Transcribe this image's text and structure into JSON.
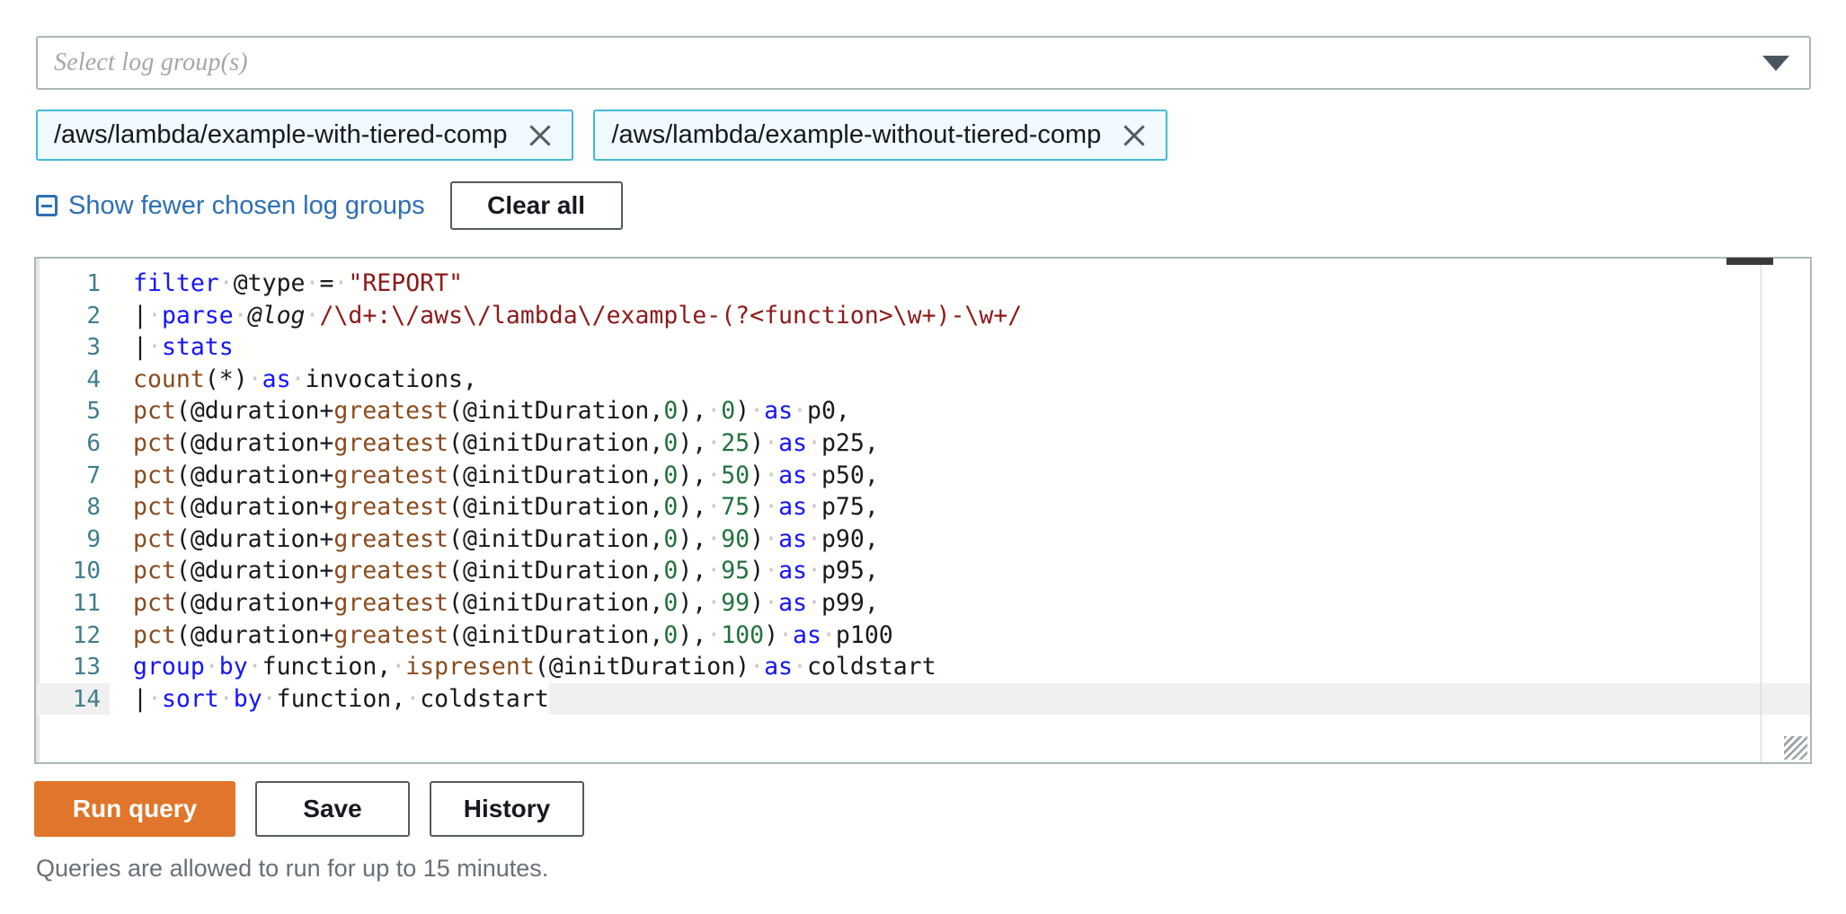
{
  "log_group_select": {
    "placeholder": "Select log group(s)",
    "caret_icon": "chevron-down-icon"
  },
  "selected_log_groups": [
    {
      "label": "/aws/lambda/example-with-tiered-comp",
      "remove_icon": "close-icon"
    },
    {
      "label": "/aws/lambda/example-without-tiered-comp",
      "remove_icon": "close-icon"
    }
  ],
  "controls": {
    "show_fewer_label": "Show fewer chosen log groups",
    "show_fewer_icon": "collapse-minus-icon",
    "clear_all_label": "Clear all"
  },
  "editor": {
    "active_line": 14,
    "lines": [
      {
        "n": "1",
        "tokens": [
          {
            "t": "filter",
            "c": "kw"
          },
          {
            "t": " ",
            "c": "dot"
          },
          {
            "t": "@type",
            "c": "var"
          },
          {
            "t": " ",
            "c": "dot"
          },
          {
            "t": "=",
            "c": "plain"
          },
          {
            "t": " ",
            "c": "dot"
          },
          {
            "t": "\"REPORT\"",
            "c": "str"
          }
        ]
      },
      {
        "n": "2",
        "tokens": [
          {
            "t": "|",
            "c": "pipe"
          },
          {
            "t": " ",
            "c": "dot"
          },
          {
            "t": "parse",
            "c": "kw"
          },
          {
            "t": " ",
            "c": "dot"
          },
          {
            "t": "@log",
            "c": "varI"
          },
          {
            "t": " ",
            "c": "dot"
          },
          {
            "t": "/\\d+:\\/aws\\/lambda\\/example-(?<function>\\w+)-\\w+/",
            "c": "str"
          }
        ]
      },
      {
        "n": "3",
        "tokens": [
          {
            "t": "|",
            "c": "pipe"
          },
          {
            "t": " ",
            "c": "dot"
          },
          {
            "t": "stats",
            "c": "kw"
          }
        ]
      },
      {
        "n": "4",
        "tokens": [
          {
            "t": "count",
            "c": "fn"
          },
          {
            "t": "(*)",
            "c": "plain"
          },
          {
            "t": " ",
            "c": "dot"
          },
          {
            "t": "as",
            "c": "kw"
          },
          {
            "t": " ",
            "c": "dot"
          },
          {
            "t": "invocations,",
            "c": "plain"
          }
        ]
      },
      {
        "n": "5",
        "tokens": [
          {
            "t": "pct",
            "c": "fn"
          },
          {
            "t": "(@duration+",
            "c": "plain"
          },
          {
            "t": "greatest",
            "c": "fn"
          },
          {
            "t": "(@initDuration,",
            "c": "plain"
          },
          {
            "t": "0",
            "c": "num"
          },
          {
            "t": "),",
            "c": "plain"
          },
          {
            "t": " ",
            "c": "dot"
          },
          {
            "t": "0",
            "c": "num"
          },
          {
            "t": ")",
            "c": "plain"
          },
          {
            "t": " ",
            "c": "dot"
          },
          {
            "t": "as",
            "c": "kw"
          },
          {
            "t": " ",
            "c": "dot"
          },
          {
            "t": "p0,",
            "c": "plain"
          }
        ]
      },
      {
        "n": "6",
        "tokens": [
          {
            "t": "pct",
            "c": "fn"
          },
          {
            "t": "(@duration+",
            "c": "plain"
          },
          {
            "t": "greatest",
            "c": "fn"
          },
          {
            "t": "(@initDuration,",
            "c": "plain"
          },
          {
            "t": "0",
            "c": "num"
          },
          {
            "t": "),",
            "c": "plain"
          },
          {
            "t": " ",
            "c": "dot"
          },
          {
            "t": "25",
            "c": "num"
          },
          {
            "t": ")",
            "c": "plain"
          },
          {
            "t": " ",
            "c": "dot"
          },
          {
            "t": "as",
            "c": "kw"
          },
          {
            "t": " ",
            "c": "dot"
          },
          {
            "t": "p25,",
            "c": "plain"
          }
        ]
      },
      {
        "n": "7",
        "tokens": [
          {
            "t": "pct",
            "c": "fn"
          },
          {
            "t": "(@duration+",
            "c": "plain"
          },
          {
            "t": "greatest",
            "c": "fn"
          },
          {
            "t": "(@initDuration,",
            "c": "plain"
          },
          {
            "t": "0",
            "c": "num"
          },
          {
            "t": "),",
            "c": "plain"
          },
          {
            "t": " ",
            "c": "dot"
          },
          {
            "t": "50",
            "c": "num"
          },
          {
            "t": ")",
            "c": "plain"
          },
          {
            "t": " ",
            "c": "dot"
          },
          {
            "t": "as",
            "c": "kw"
          },
          {
            "t": " ",
            "c": "dot"
          },
          {
            "t": "p50,",
            "c": "plain"
          }
        ]
      },
      {
        "n": "8",
        "tokens": [
          {
            "t": "pct",
            "c": "fn"
          },
          {
            "t": "(@duration+",
            "c": "plain"
          },
          {
            "t": "greatest",
            "c": "fn"
          },
          {
            "t": "(@initDuration,",
            "c": "plain"
          },
          {
            "t": "0",
            "c": "num"
          },
          {
            "t": "),",
            "c": "plain"
          },
          {
            "t": " ",
            "c": "dot"
          },
          {
            "t": "75",
            "c": "num"
          },
          {
            "t": ")",
            "c": "plain"
          },
          {
            "t": " ",
            "c": "dot"
          },
          {
            "t": "as",
            "c": "kw"
          },
          {
            "t": " ",
            "c": "dot"
          },
          {
            "t": "p75,",
            "c": "plain"
          }
        ]
      },
      {
        "n": "9",
        "tokens": [
          {
            "t": "pct",
            "c": "fn"
          },
          {
            "t": "(@duration+",
            "c": "plain"
          },
          {
            "t": "greatest",
            "c": "fn"
          },
          {
            "t": "(@initDuration,",
            "c": "plain"
          },
          {
            "t": "0",
            "c": "num"
          },
          {
            "t": "),",
            "c": "plain"
          },
          {
            "t": " ",
            "c": "dot"
          },
          {
            "t": "90",
            "c": "num"
          },
          {
            "t": ")",
            "c": "plain"
          },
          {
            "t": " ",
            "c": "dot"
          },
          {
            "t": "as",
            "c": "kw"
          },
          {
            "t": " ",
            "c": "dot"
          },
          {
            "t": "p90,",
            "c": "plain"
          }
        ]
      },
      {
        "n": "10",
        "tokens": [
          {
            "t": "pct",
            "c": "fn"
          },
          {
            "t": "(@duration+",
            "c": "plain"
          },
          {
            "t": "greatest",
            "c": "fn"
          },
          {
            "t": "(@initDuration,",
            "c": "plain"
          },
          {
            "t": "0",
            "c": "num"
          },
          {
            "t": "),",
            "c": "plain"
          },
          {
            "t": " ",
            "c": "dot"
          },
          {
            "t": "95",
            "c": "num"
          },
          {
            "t": ")",
            "c": "plain"
          },
          {
            "t": " ",
            "c": "dot"
          },
          {
            "t": "as",
            "c": "kw"
          },
          {
            "t": " ",
            "c": "dot"
          },
          {
            "t": "p95,",
            "c": "plain"
          }
        ]
      },
      {
        "n": "11",
        "tokens": [
          {
            "t": "pct",
            "c": "fn"
          },
          {
            "t": "(@duration+",
            "c": "plain"
          },
          {
            "t": "greatest",
            "c": "fn"
          },
          {
            "t": "(@initDuration,",
            "c": "plain"
          },
          {
            "t": "0",
            "c": "num"
          },
          {
            "t": "),",
            "c": "plain"
          },
          {
            "t": " ",
            "c": "dot"
          },
          {
            "t": "99",
            "c": "num"
          },
          {
            "t": ")",
            "c": "plain"
          },
          {
            "t": " ",
            "c": "dot"
          },
          {
            "t": "as",
            "c": "kw"
          },
          {
            "t": " ",
            "c": "dot"
          },
          {
            "t": "p99,",
            "c": "plain"
          }
        ]
      },
      {
        "n": "12",
        "tokens": [
          {
            "t": "pct",
            "c": "fn"
          },
          {
            "t": "(@duration+",
            "c": "plain"
          },
          {
            "t": "greatest",
            "c": "fn"
          },
          {
            "t": "(@initDuration,",
            "c": "plain"
          },
          {
            "t": "0",
            "c": "num"
          },
          {
            "t": "),",
            "c": "plain"
          },
          {
            "t": " ",
            "c": "dot"
          },
          {
            "t": "100",
            "c": "num"
          },
          {
            "t": ")",
            "c": "plain"
          },
          {
            "t": " ",
            "c": "dot"
          },
          {
            "t": "as",
            "c": "kw"
          },
          {
            "t": " ",
            "c": "dot"
          },
          {
            "t": "p100",
            "c": "plain"
          }
        ]
      },
      {
        "n": "13",
        "tokens": [
          {
            "t": "group",
            "c": "kw"
          },
          {
            "t": " ",
            "c": "dot"
          },
          {
            "t": "by",
            "c": "kw"
          },
          {
            "t": " ",
            "c": "dot"
          },
          {
            "t": "function,",
            "c": "plain"
          },
          {
            "t": " ",
            "c": "dot"
          },
          {
            "t": "ispresent",
            "c": "fn"
          },
          {
            "t": "(@initDuration)",
            "c": "plain"
          },
          {
            "t": " ",
            "c": "dot"
          },
          {
            "t": "as",
            "c": "kw"
          },
          {
            "t": " ",
            "c": "dot"
          },
          {
            "t": "coldstart",
            "c": "plain"
          }
        ]
      },
      {
        "n": "14",
        "tokens": [
          {
            "t": "|",
            "c": "pipe"
          },
          {
            "t": " ",
            "c": "dot"
          },
          {
            "t": "sort",
            "c": "kw"
          },
          {
            "t": " ",
            "c": "dot"
          },
          {
            "t": "by",
            "c": "kw"
          },
          {
            "t": " ",
            "c": "dot"
          },
          {
            "t": "function,",
            "c": "plain"
          },
          {
            "t": " ",
            "c": "dot"
          },
          {
            "t": "coldstart",
            "c": "plain"
          }
        ]
      }
    ]
  },
  "actions": {
    "run_query_label": "Run query",
    "save_label": "Save",
    "history_label": "History"
  },
  "footer": {
    "note": "Queries are allowed to run for up to 15 minutes."
  },
  "colors": {
    "primary_button": "#e0762b",
    "link": "#2d6fb5",
    "token_border": "#44b9d6",
    "token_bg": "#f1faff",
    "keyword": "#1414ff",
    "function": "#8a4b1e",
    "string": "#8c1a1a",
    "number": "#22713f",
    "line_number": "#3f7e8c"
  }
}
